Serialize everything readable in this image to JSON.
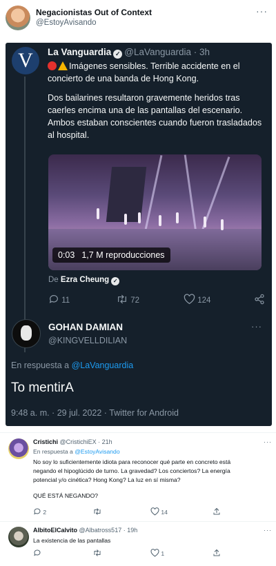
{
  "header_tweet": {
    "name": "Negacionistas Out of Context",
    "handle": "@EstoyAvisando",
    "more_icon": "more-dots-icon"
  },
  "quoted": {
    "lavanguardia": {
      "avatar_letter": "V",
      "name": "La Vanguardia",
      "handle_time": "@LaVanguardia · 3h",
      "line1": "Imágenes sensibles. Terrible accidente en el concierto de una banda de Hong Kong.",
      "line2": "Dos bailarines resultaron gravemente heridos tras caerles encima una de las pantallas del escenario. Ambos estaban conscientes cuando fueron trasladados al hospital.",
      "video_time": "0:03",
      "video_views": "1,7 M reproducciones",
      "from_prefix": "De",
      "from_name": "Ezra Cheung",
      "replies": "11",
      "retweets": "72",
      "likes": "124"
    },
    "gohan": {
      "name": "GOHAN DAMIAN",
      "handle": "@KINGVELLDILIAN",
      "reply_prefix": "En respuesta a",
      "reply_to": "@LaVanguardia",
      "text": "To mentirA",
      "meta": "9:48 a. m. · 29 jul. 2022 · Twitter for Android"
    }
  },
  "replies": [
    {
      "name": "Cristichi",
      "handle_time": "@CristichiEX · 21h",
      "reply_prefix": "En respuesta a",
      "reply_to": "@EstoyAvisando",
      "text": "No soy lo suficientemente idiota para reconocer qué parte en concreto está negando el hipoglúcido de turno. La gravedad? Los conciertos? La energía potencial y/o cinética? Hong Kong? La luz en sí misma?",
      "text2": "QUÉ ESTÁ NEGANDO?",
      "replies": "2",
      "retweets": "",
      "likes": "14"
    },
    {
      "name": "AlbitoElCalvito",
      "handle_time": "@Albatross517 · 19h",
      "text": "La existencia de las pantallas",
      "replies": "",
      "retweets": "",
      "likes": "1"
    }
  ],
  "colors": {
    "dark_bg": "#15202b",
    "link": "#1d9bf0",
    "muted": "#536471"
  }
}
